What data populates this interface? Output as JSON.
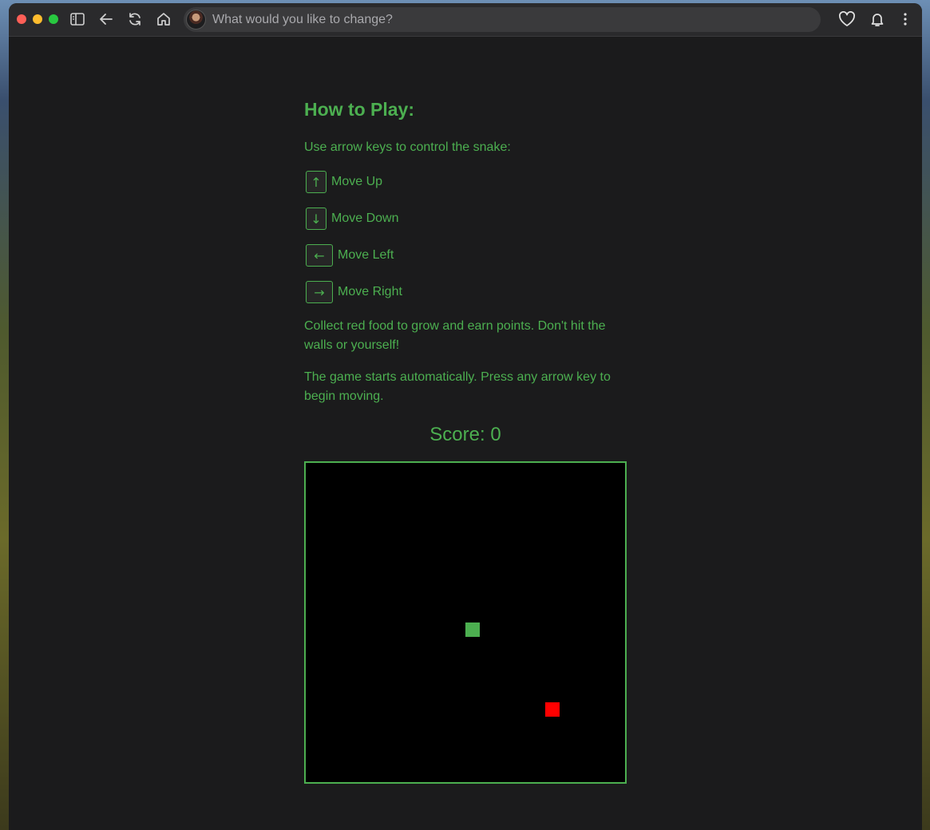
{
  "browser": {
    "address_placeholder": "What would you like to change?",
    "icons": [
      "sidebar-icon",
      "back-arrow-icon",
      "reload-icon",
      "home-icon",
      "heart-icon",
      "bell-icon",
      "more-vertical-icon"
    ]
  },
  "instructions": {
    "title": "How to Play:",
    "intro": "Use arrow keys to control the snake:",
    "controls": [
      {
        "key": "↑",
        "label": "Move Up"
      },
      {
        "key": "↓",
        "label": "Move Down"
      },
      {
        "key": "←",
        "label": "Move Left"
      },
      {
        "key": "→",
        "label": "Move Right"
      }
    ],
    "goal": "Collect red food to grow and earn points. Don't hit the walls or yourself!",
    "start": "The game starts automatically. Press any arrow key to begin moving."
  },
  "game": {
    "score_label": "Score: 0",
    "grid_size": 20,
    "snake": [
      {
        "col": 10,
        "row": 10
      }
    ],
    "food": {
      "col": 15,
      "row": 15
    },
    "snake_color": "#4caf50",
    "food_color": "#ff0000",
    "board_color": "#000000"
  },
  "theme": {
    "accent": "#4caf50",
    "page_bg": "#1b1b1c"
  }
}
